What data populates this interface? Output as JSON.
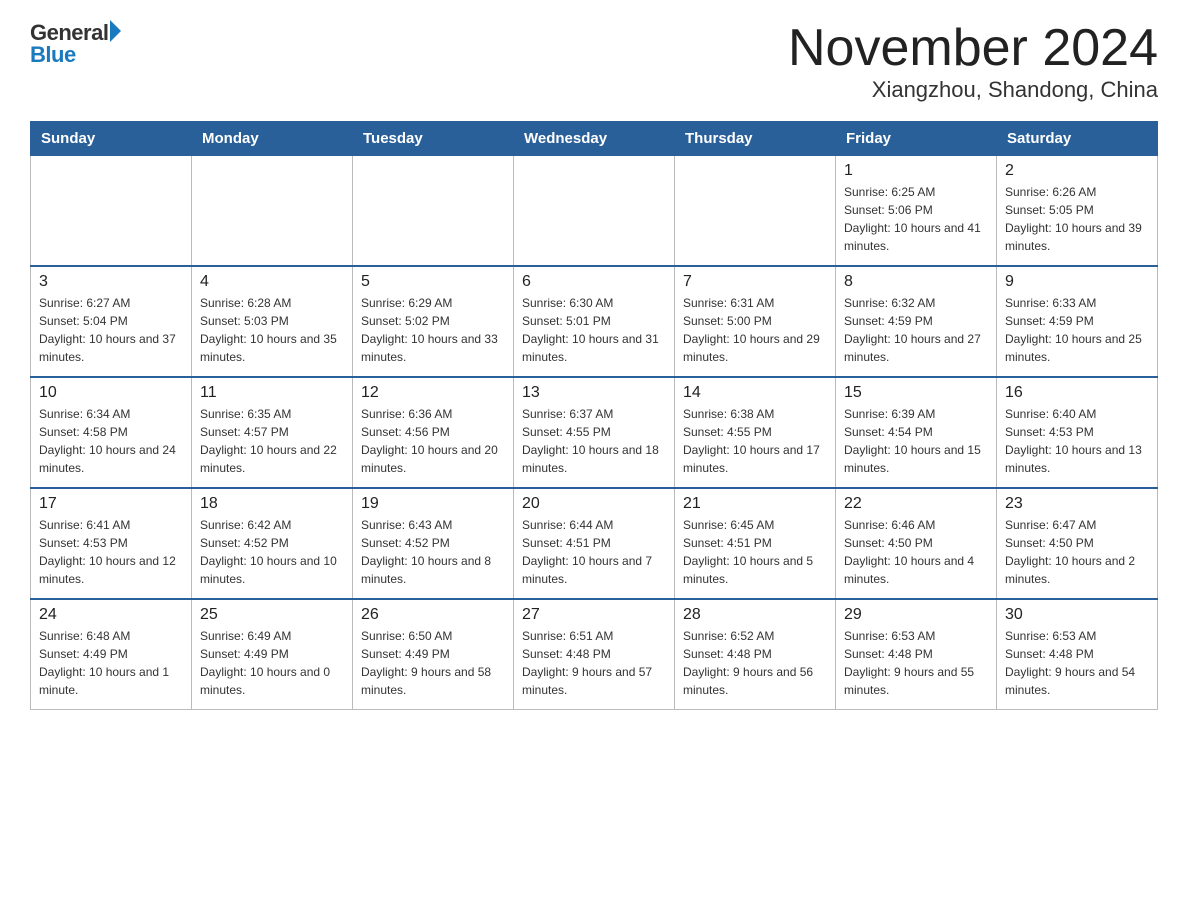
{
  "header": {
    "logo": {
      "general": "General",
      "arrow": "▶",
      "blue": "Blue"
    },
    "title": "November 2024",
    "location": "Xiangzhou, Shandong, China"
  },
  "days_of_week": [
    "Sunday",
    "Monday",
    "Tuesday",
    "Wednesday",
    "Thursday",
    "Friday",
    "Saturday"
  ],
  "weeks": [
    [
      {
        "day": "",
        "info": ""
      },
      {
        "day": "",
        "info": ""
      },
      {
        "day": "",
        "info": ""
      },
      {
        "day": "",
        "info": ""
      },
      {
        "day": "",
        "info": ""
      },
      {
        "day": "1",
        "info": "Sunrise: 6:25 AM\nSunset: 5:06 PM\nDaylight: 10 hours and 41 minutes."
      },
      {
        "day": "2",
        "info": "Sunrise: 6:26 AM\nSunset: 5:05 PM\nDaylight: 10 hours and 39 minutes."
      }
    ],
    [
      {
        "day": "3",
        "info": "Sunrise: 6:27 AM\nSunset: 5:04 PM\nDaylight: 10 hours and 37 minutes."
      },
      {
        "day": "4",
        "info": "Sunrise: 6:28 AM\nSunset: 5:03 PM\nDaylight: 10 hours and 35 minutes."
      },
      {
        "day": "5",
        "info": "Sunrise: 6:29 AM\nSunset: 5:02 PM\nDaylight: 10 hours and 33 minutes."
      },
      {
        "day": "6",
        "info": "Sunrise: 6:30 AM\nSunset: 5:01 PM\nDaylight: 10 hours and 31 minutes."
      },
      {
        "day": "7",
        "info": "Sunrise: 6:31 AM\nSunset: 5:00 PM\nDaylight: 10 hours and 29 minutes."
      },
      {
        "day": "8",
        "info": "Sunrise: 6:32 AM\nSunset: 4:59 PM\nDaylight: 10 hours and 27 minutes."
      },
      {
        "day": "9",
        "info": "Sunrise: 6:33 AM\nSunset: 4:59 PM\nDaylight: 10 hours and 25 minutes."
      }
    ],
    [
      {
        "day": "10",
        "info": "Sunrise: 6:34 AM\nSunset: 4:58 PM\nDaylight: 10 hours and 24 minutes."
      },
      {
        "day": "11",
        "info": "Sunrise: 6:35 AM\nSunset: 4:57 PM\nDaylight: 10 hours and 22 minutes."
      },
      {
        "day": "12",
        "info": "Sunrise: 6:36 AM\nSunset: 4:56 PM\nDaylight: 10 hours and 20 minutes."
      },
      {
        "day": "13",
        "info": "Sunrise: 6:37 AM\nSunset: 4:55 PM\nDaylight: 10 hours and 18 minutes."
      },
      {
        "day": "14",
        "info": "Sunrise: 6:38 AM\nSunset: 4:55 PM\nDaylight: 10 hours and 17 minutes."
      },
      {
        "day": "15",
        "info": "Sunrise: 6:39 AM\nSunset: 4:54 PM\nDaylight: 10 hours and 15 minutes."
      },
      {
        "day": "16",
        "info": "Sunrise: 6:40 AM\nSunset: 4:53 PM\nDaylight: 10 hours and 13 minutes."
      }
    ],
    [
      {
        "day": "17",
        "info": "Sunrise: 6:41 AM\nSunset: 4:53 PM\nDaylight: 10 hours and 12 minutes."
      },
      {
        "day": "18",
        "info": "Sunrise: 6:42 AM\nSunset: 4:52 PM\nDaylight: 10 hours and 10 minutes."
      },
      {
        "day": "19",
        "info": "Sunrise: 6:43 AM\nSunset: 4:52 PM\nDaylight: 10 hours and 8 minutes."
      },
      {
        "day": "20",
        "info": "Sunrise: 6:44 AM\nSunset: 4:51 PM\nDaylight: 10 hours and 7 minutes."
      },
      {
        "day": "21",
        "info": "Sunrise: 6:45 AM\nSunset: 4:51 PM\nDaylight: 10 hours and 5 minutes."
      },
      {
        "day": "22",
        "info": "Sunrise: 6:46 AM\nSunset: 4:50 PM\nDaylight: 10 hours and 4 minutes."
      },
      {
        "day": "23",
        "info": "Sunrise: 6:47 AM\nSunset: 4:50 PM\nDaylight: 10 hours and 2 minutes."
      }
    ],
    [
      {
        "day": "24",
        "info": "Sunrise: 6:48 AM\nSunset: 4:49 PM\nDaylight: 10 hours and 1 minute."
      },
      {
        "day": "25",
        "info": "Sunrise: 6:49 AM\nSunset: 4:49 PM\nDaylight: 10 hours and 0 minutes."
      },
      {
        "day": "26",
        "info": "Sunrise: 6:50 AM\nSunset: 4:49 PM\nDaylight: 9 hours and 58 minutes."
      },
      {
        "day": "27",
        "info": "Sunrise: 6:51 AM\nSunset: 4:48 PM\nDaylight: 9 hours and 57 minutes."
      },
      {
        "day": "28",
        "info": "Sunrise: 6:52 AM\nSunset: 4:48 PM\nDaylight: 9 hours and 56 minutes."
      },
      {
        "day": "29",
        "info": "Sunrise: 6:53 AM\nSunset: 4:48 PM\nDaylight: 9 hours and 55 minutes."
      },
      {
        "day": "30",
        "info": "Sunrise: 6:53 AM\nSunset: 4:48 PM\nDaylight: 9 hours and 54 minutes."
      }
    ]
  ]
}
